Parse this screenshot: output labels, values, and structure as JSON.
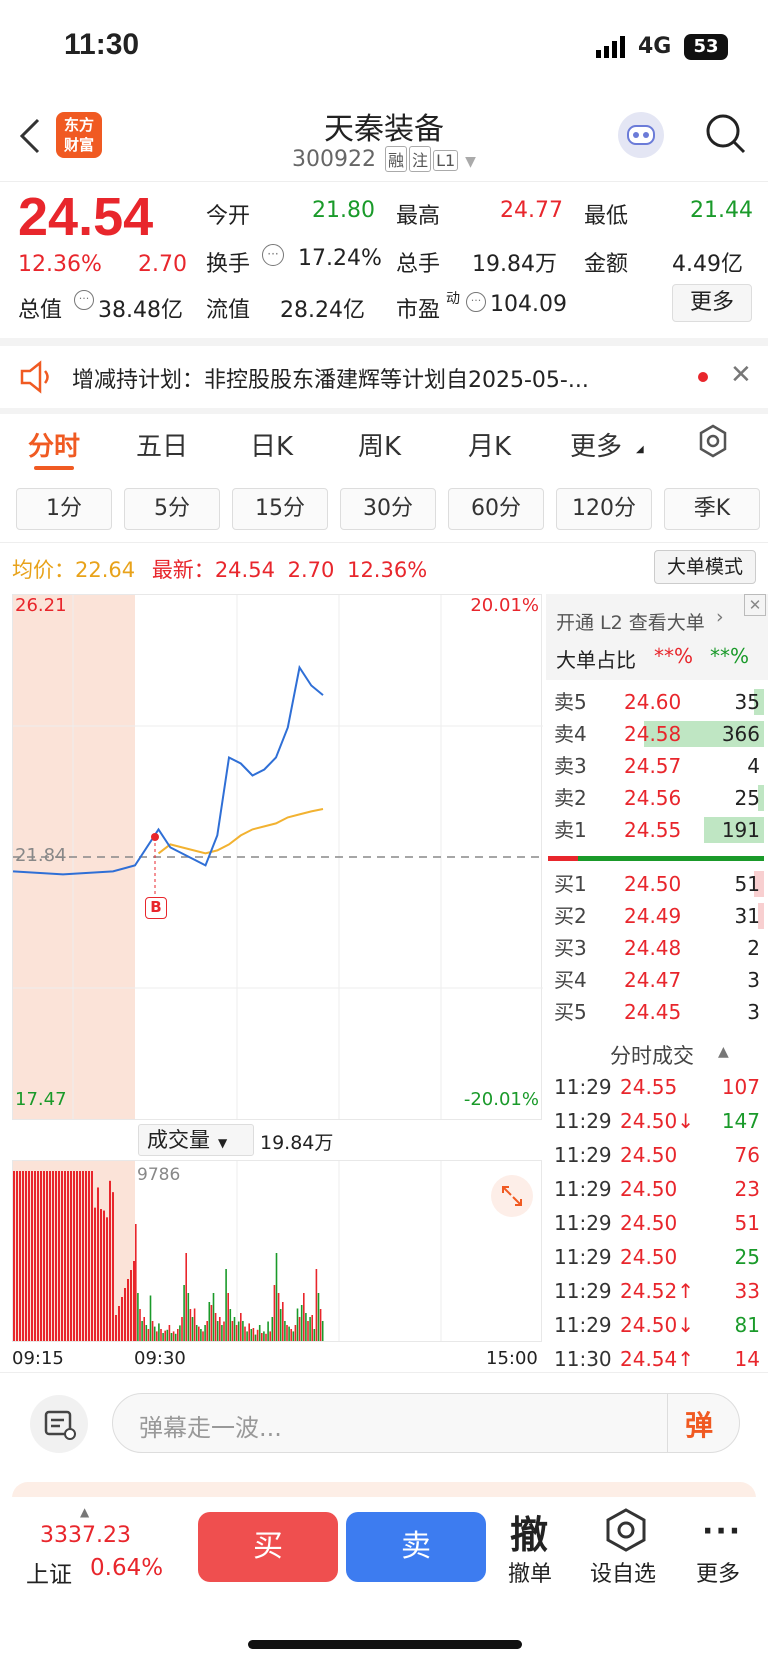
{
  "status": {
    "time": "11:30",
    "network": "4G",
    "battery": "53"
  },
  "header": {
    "logo_line1": "东方",
    "logo_line2": "财富",
    "title": "天秦装备",
    "code": "300922",
    "tags": [
      "融",
      "注",
      "L1"
    ]
  },
  "quote": {
    "price": "24.54",
    "pct": "12.36%",
    "change": "2.70",
    "fields": [
      {
        "label": "今开",
        "value": "21.80",
        "color": "green"
      },
      {
        "label": "最高",
        "value": "24.77",
        "color": "red"
      },
      {
        "label": "最低",
        "value": "21.44",
        "color": "green"
      },
      {
        "label": "换手",
        "value": "17.24%",
        "color": "black"
      },
      {
        "label": "总手",
        "value": "19.84万",
        "color": "black"
      },
      {
        "label": "金额",
        "value": "4.49亿",
        "color": "black"
      },
      {
        "label": "总值",
        "value": "38.48亿",
        "color": "black"
      },
      {
        "label": "流值",
        "value": "28.24亿",
        "color": "black"
      },
      {
        "label": "市盈",
        "value": "104.09",
        "color": "black"
      }
    ],
    "pe_sup": "动",
    "more": "更多"
  },
  "notice": {
    "text": "增减持计划：非控股股东潘建辉等计划自2025-05-..."
  },
  "tabs": [
    "分时",
    "五日",
    "日K",
    "周K",
    "月K",
    "更多"
  ],
  "minute_tabs": [
    "1分",
    "5分",
    "15分",
    "30分",
    "60分",
    "120分",
    "季K"
  ],
  "info": {
    "avg_label": "均价：",
    "avg": "22.64",
    "latest_label": "最新：",
    "latest": "24.54",
    "chg": "2.70",
    "pct": "12.36%",
    "mode": "大单模式"
  },
  "chart_labels": {
    "top_price": "26.21",
    "top_pct": "20.01%",
    "mid_price": "21.84",
    "bot_price": "17.47",
    "bot_pct": "-20.01%",
    "marker": "B"
  },
  "volume": {
    "label": "成交量",
    "total": "19.84万",
    "peak": "9786",
    "t_start": "09:15",
    "t_open": "09:30",
    "t_end": "15:00"
  },
  "chart_data": {
    "type": "line",
    "ylim": [
      17.47,
      26.21
    ],
    "x": [
      0,
      10,
      20,
      30,
      40,
      45,
      50,
      55,
      60,
      65,
      70,
      75,
      80,
      85,
      90,
      95,
      100,
      105,
      110
    ],
    "series": [
      {
        "name": "最新",
        "values": [
          21.6,
          21.55,
          21.6,
          21.7,
          22.3,
          22.0,
          21.9,
          21.8,
          21.7,
          22.2,
          23.5,
          23.4,
          23.2,
          23.3,
          23.5,
          24.0,
          25.0,
          24.7,
          24.54
        ]
      },
      {
        "name": "均价",
        "values": [
          null,
          null,
          null,
          null,
          21.9,
          22.05,
          22.0,
          21.95,
          21.9,
          21.95,
          22.05,
          22.2,
          22.3,
          22.35,
          22.4,
          22.5,
          22.55,
          22.6,
          22.64
        ]
      }
    ]
  },
  "l2": {
    "promo": "开通 L2 查看大单",
    "ratio_label": "大单占比",
    "ratio1": "**%",
    "ratio2": "**%"
  },
  "asks": [
    {
      "l": "卖5",
      "p": "24.60",
      "v": "35",
      "w": 0.05
    },
    {
      "l": "卖4",
      "p": "24.58",
      "v": "366",
      "w": 0.6
    },
    {
      "l": "卖3",
      "p": "24.57",
      "v": "4",
      "w": 0
    },
    {
      "l": "卖2",
      "p": "24.56",
      "v": "25",
      "w": 0.03
    },
    {
      "l": "卖1",
      "p": "24.55",
      "v": "191",
      "w": 0.3
    }
  ],
  "bids": [
    {
      "l": "买1",
      "p": "24.50",
      "v": "51",
      "w": 0.05
    },
    {
      "l": "买2",
      "p": "24.49",
      "v": "31",
      "w": 0.03
    },
    {
      "l": "买3",
      "p": "24.48",
      "v": "2",
      "w": 0
    },
    {
      "l": "买4",
      "p": "24.47",
      "v": "3",
      "w": 0
    },
    {
      "l": "买5",
      "p": "24.45",
      "v": "3",
      "w": 0
    }
  ],
  "trades_title": "分时成交",
  "trades": [
    {
      "t": "11:29",
      "p": "24.55",
      "arrow": "",
      "v": "107",
      "c": "red"
    },
    {
      "t": "11:29",
      "p": "24.50",
      "arrow": "↓",
      "v": "147",
      "c": "green"
    },
    {
      "t": "11:29",
      "p": "24.50",
      "arrow": "",
      "v": "76",
      "c": "red"
    },
    {
      "t": "11:29",
      "p": "24.50",
      "arrow": "",
      "v": "23",
      "c": "red"
    },
    {
      "t": "11:29",
      "p": "24.50",
      "arrow": "",
      "v": "51",
      "c": "red"
    },
    {
      "t": "11:29",
      "p": "24.50",
      "arrow": "",
      "v": "25",
      "c": "green"
    },
    {
      "t": "11:29",
      "p": "24.52",
      "arrow": "↑",
      "v": "33",
      "c": "red"
    },
    {
      "t": "11:29",
      "p": "24.50",
      "arrow": "↓",
      "v": "81",
      "c": "green"
    },
    {
      "t": "11:30",
      "p": "24.54",
      "arrow": "↑",
      "v": "14",
      "c": "red"
    }
  ],
  "comment": {
    "placeholder": "弹幕走一波...",
    "btn": "弹"
  },
  "footer": {
    "index": "3337.23",
    "index_name": "上证",
    "index_pct": "0.64%",
    "buy": "买",
    "sell": "卖",
    "cancel_icon": "撤",
    "cancel": "撤单",
    "watch": "设自选",
    "more": "更多"
  }
}
